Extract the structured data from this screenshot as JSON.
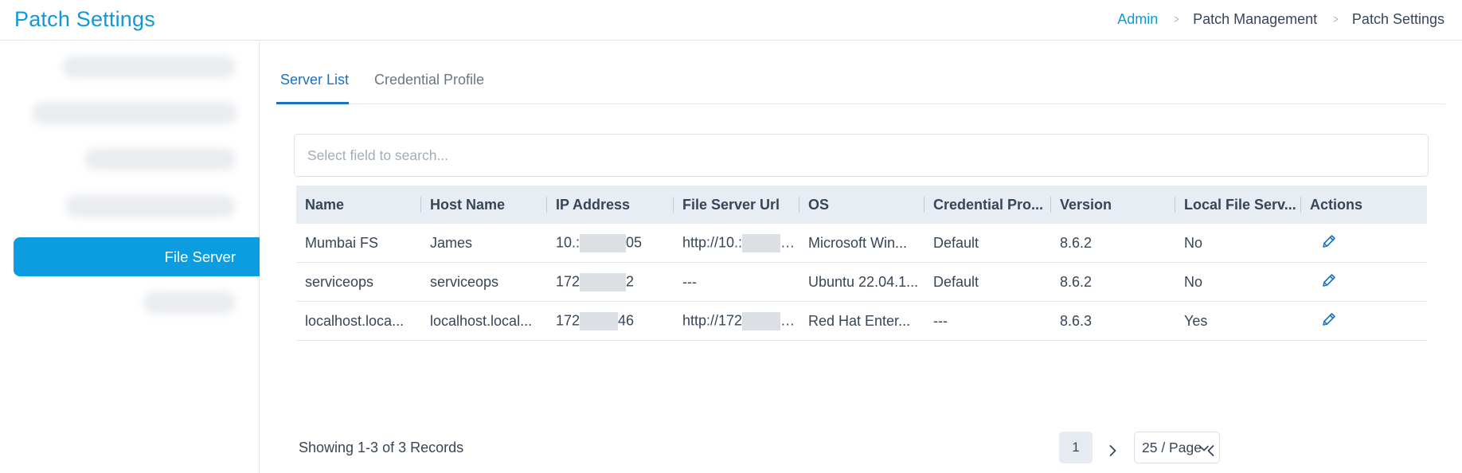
{
  "header": {
    "title": "Patch Settings",
    "breadcrumb": [
      "Admin",
      "Patch Management",
      "Patch Settings"
    ]
  },
  "sidebar": {
    "active_item": "File Server"
  },
  "tabs": [
    {
      "label": "Server List",
      "active": true
    },
    {
      "label": "Credential Profile",
      "active": false
    }
  ],
  "search": {
    "placeholder": "Select field to search..."
  },
  "table": {
    "columns": [
      "Name",
      "Host Name",
      "IP Address",
      "File Server Url",
      "OS",
      "Credential Pro...",
      "Version",
      "Local File Serv...",
      "Actions"
    ],
    "rows": [
      {
        "name": "Mumbai FS",
        "host": "James",
        "ip_prefix": "10.:",
        "ip_suffix": "05",
        "url": "http://10.:",
        "os": "Microsoft Win...",
        "credential": "Default",
        "version": "8.6.2",
        "local": "No"
      },
      {
        "name": "serviceops",
        "host": "serviceops",
        "ip_prefix": "172",
        "ip_suffix": "2",
        "url": "---",
        "os": "Ubuntu 22.04.1...",
        "credential": "Default",
        "version": "8.6.2",
        "local": "No"
      },
      {
        "name": "localhost.loca...",
        "host": "localhost.local...",
        "ip_prefix": "172",
        "ip_suffix": "46",
        "url": "http://172",
        "os": "Red Hat Enter...",
        "credential": "---",
        "version": "8.6.3",
        "local": "Yes"
      }
    ]
  },
  "footer": {
    "records": "Showing 1-3 of 3 Records",
    "current_page": "1",
    "page_size": "25 / Page"
  },
  "colors": {
    "accent": "#0f99d8",
    "active_tab": "#1a72c2",
    "sidebar_active": "#0b9de0"
  }
}
